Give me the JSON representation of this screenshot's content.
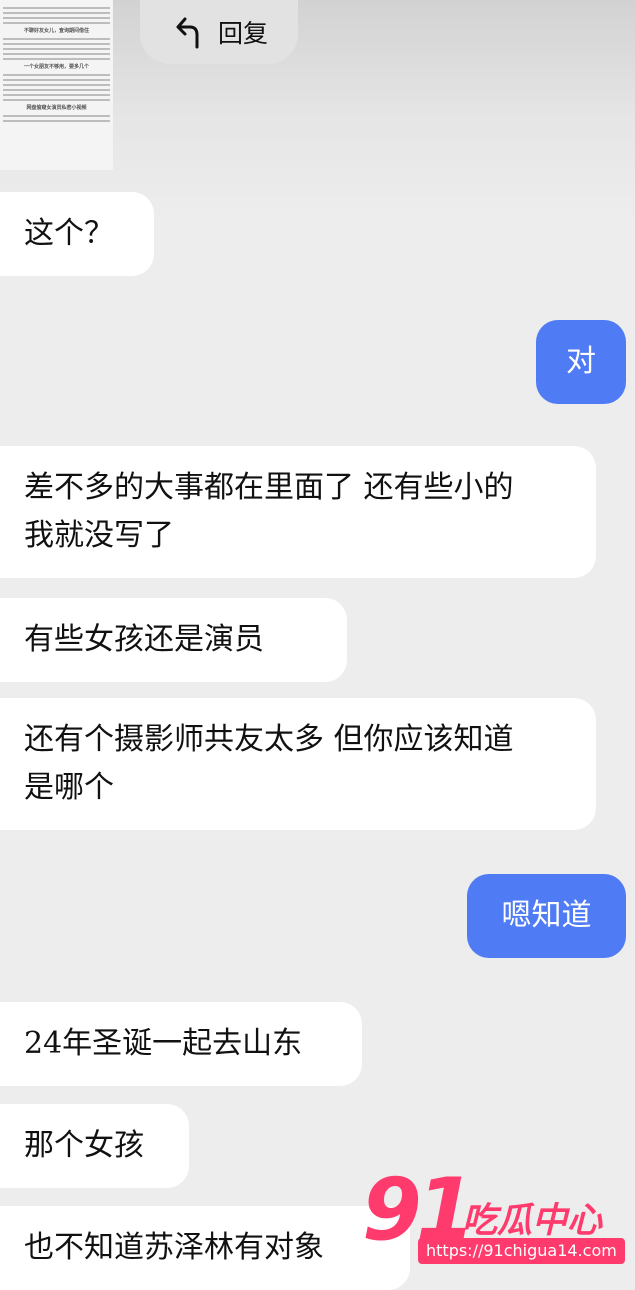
{
  "reply": {
    "label": "回复"
  },
  "thumbnail": {
    "heading1": "不聊好友女儿，查询期间借住",
    "heading2": "一个女朋友不够用，要多几个",
    "heading3": "网盘偷窥女演员私密小视频"
  },
  "messages": [
    {
      "side": "left",
      "text": "这个？"
    },
    {
      "side": "right",
      "text": "对"
    },
    {
      "side": "left",
      "line1": "差不多的大事都在里面了 还有些小的",
      "line2": "我就没写了"
    },
    {
      "side": "left",
      "text": "有些女孩还是演员"
    },
    {
      "side": "left",
      "line1": "还有个摄影师共友太多 但你应该知道",
      "line2": "是哪个"
    },
    {
      "side": "right",
      "text": "嗯知道"
    },
    {
      "side": "left",
      "text": "24年圣诞一起去山东"
    },
    {
      "side": "left",
      "text": "那个女孩"
    },
    {
      "side": "left",
      "text": "也不知道苏泽林有对象"
    }
  ],
  "watermark": {
    "number": "91",
    "name": "吃瓜中心",
    "url": "https://91chigua14.com",
    "color": "#ff3b6e"
  }
}
